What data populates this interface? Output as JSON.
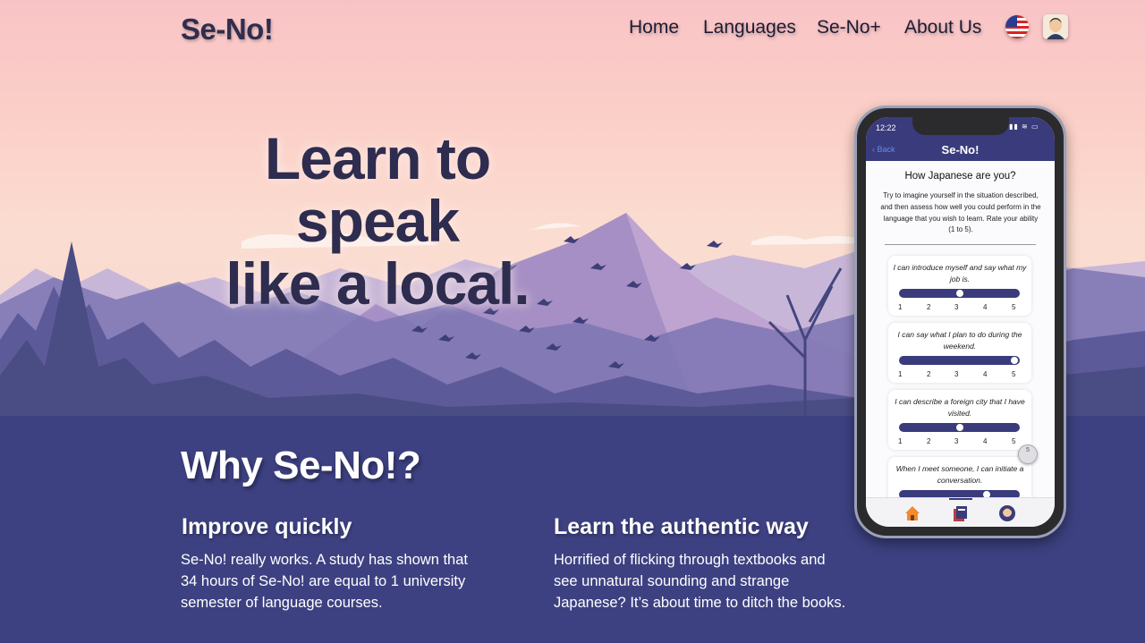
{
  "nav": {
    "logo": "Se-No!",
    "links": [
      "Home",
      "Languages",
      "Se-No+",
      "About Us"
    ]
  },
  "hero": {
    "headline_line1": "Learn to speak",
    "headline_line2": "like a local."
  },
  "why": {
    "title": "Why Se-No!?",
    "features": [
      {
        "title": "Improve quickly",
        "text": "Se-No! really works. A study has shown that 34 hours of Se-No! are equal to 1 university semester of language courses."
      },
      {
        "title": "Learn the authentic way",
        "text": "Horrified of flicking through textbooks and see unnatural sounding and strange Japanese? It’s about time to ditch the books."
      }
    ]
  },
  "phone": {
    "time": "12:22",
    "back": "Back",
    "app_title": "Se-No!",
    "question_title": "How Japanese are you?",
    "question_desc": "Try to imagine yourself in the situation described, and then assess how well you could perform in the language that you wish to learn. Rate your ability (1 to 5).",
    "ticks": [
      "1",
      "2",
      "3",
      "4",
      "5"
    ],
    "touch_label": "5",
    "items": [
      {
        "text": "I can introduce myself and say what my job is.",
        "rating": 3
      },
      {
        "text": "I can say what I plan to do during the weekend.",
        "rating": 5
      },
      {
        "text": "I can describe a foreign city that I have visited.",
        "rating": 3
      },
      {
        "text": "When I meet someone, I can initiate a conversation.",
        "rating": 4
      }
    ]
  },
  "colors": {
    "hero_sky": "#f9c3c6",
    "primary": "#3d4181",
    "mountain": "#a58fc4",
    "forest": "#4a4c84"
  }
}
